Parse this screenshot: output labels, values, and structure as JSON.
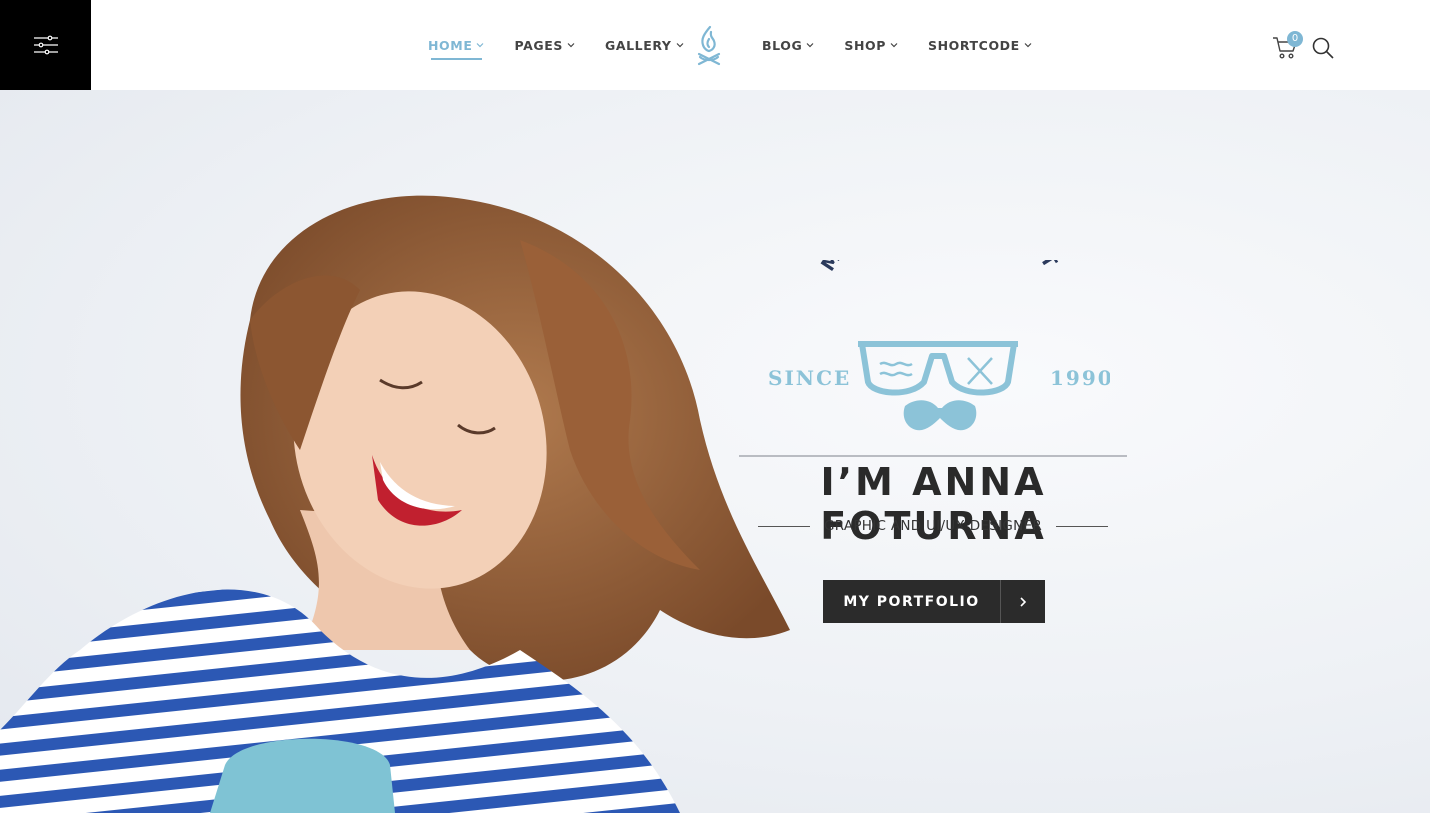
{
  "header": {
    "menu_icon": "sliders-menu-icon",
    "nav_left": [
      {
        "label": "HOME",
        "active": true
      },
      {
        "label": "PAGES",
        "active": false
      },
      {
        "label": "GALLERY",
        "active": false
      }
    ],
    "nav_right": [
      {
        "label": "BLOG",
        "active": false
      },
      {
        "label": "SHOP",
        "active": false
      },
      {
        "label": "SHORTCODE",
        "active": false
      }
    ],
    "logo_icon": "flame-logo-icon",
    "cart_count": "0",
    "cart_icon": "shopping-cart-icon",
    "search_icon": "search-icon"
  },
  "hero": {
    "badge": {
      "arc_text": "MADE WITH HEART",
      "since_label": "SINCE",
      "year": "1990"
    },
    "title": "I’M ANNA FOTURNA",
    "subtitle": "GRAPHIC AND UI/UX DESIGNER",
    "cta_label": "MY PORTFOLIO",
    "cta_icon": "chevron-right-icon"
  },
  "colors": {
    "accent": "#7fb7d4",
    "dark": "#2b2b2b",
    "badge_navy": "#2b3a5c"
  }
}
